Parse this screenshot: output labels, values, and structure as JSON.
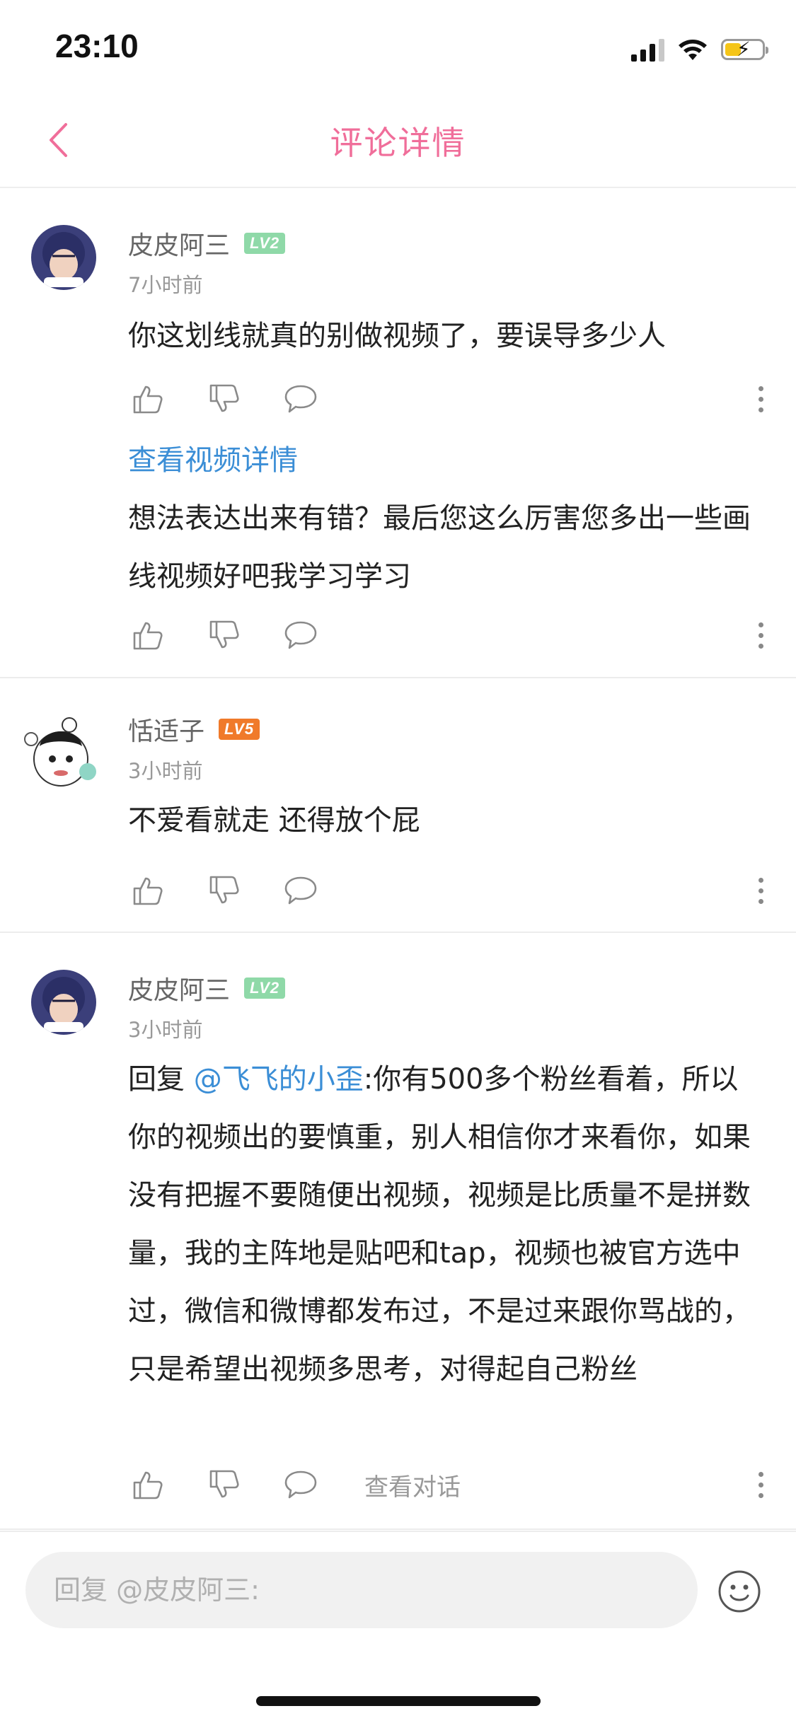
{
  "status_bar": {
    "time": "23:10"
  },
  "nav": {
    "title": "评论详情"
  },
  "colors": {
    "accent": "#f06e9a",
    "link": "#3b8ed6",
    "lv2": "#8fd9a8",
    "lv5": "#f07a2a"
  },
  "comments": [
    {
      "username": "皮皮阿三",
      "level": "LV2",
      "time": "7小时前",
      "text": "你这划线就真的别做视频了，要误导多少人",
      "link": "查看视频详情",
      "reply_text": "想法表达出来有错？最后您这么厉害您多出一些画线视频好吧我学习学习"
    },
    {
      "username": "恬适子",
      "level": "LV5",
      "time": "3小时前",
      "text": "不爱看就走 还得放个屁"
    },
    {
      "username": "皮皮阿三",
      "level": "LV2",
      "time": "3小时前",
      "reply_prefix": "回复 ",
      "mention": "@飞飞的小歪",
      "text": ":你有500多个粉丝看着，所以你的视频出的要慎重，别人相信你才来看你，如果没有把握不要随便出视频，视频是比质量不是拼数量，我的主阵地是贴吧和tap，视频也被官方选中过，微信和微博都发布过，不是过来跟你骂战的，只是希望出视频多思考，对得起自己粉丝",
      "view_conversation": "查看对话"
    }
  ],
  "reply_bar": {
    "placeholder": "回复 @皮皮阿三:"
  },
  "icons": [
    "back-chevron-icon",
    "thumb-up-icon",
    "thumb-down-icon",
    "comment-bubble-icon",
    "more-vertical-icon",
    "emoji-icon",
    "signal-icon",
    "wifi-icon",
    "battery-icon"
  ]
}
